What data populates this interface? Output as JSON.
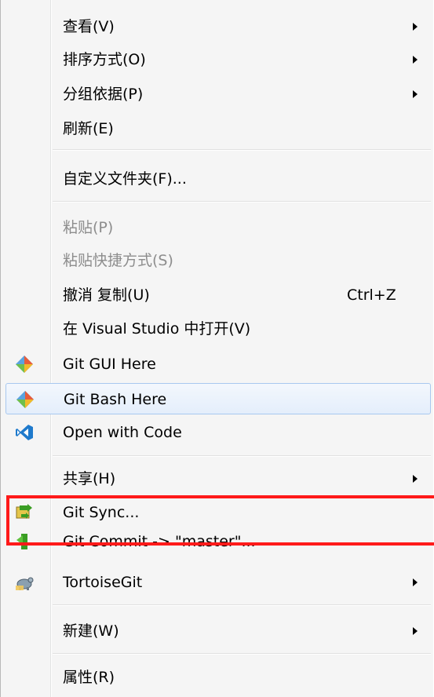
{
  "menu": {
    "view": "查看(V)",
    "sort": "排序方式(O)",
    "group": "分组依据(P)",
    "refresh": "刷新(E)",
    "customize": "自定义文件夹(F)...",
    "paste": "粘贴(P)",
    "paste_shortcut": "粘贴快捷方式(S)",
    "undo": "撤消 复制(U)",
    "undo_shortcut": "Ctrl+Z",
    "open_vs": "在 Visual Studio 中打开(V)",
    "git_gui": "Git GUI Here",
    "git_bash": "Git Bash Here",
    "open_code": "Open with Code",
    "share": "共享(H)",
    "git_sync": "Git Sync...",
    "git_commit": "Git Commit -> \"master\"...",
    "tortoise": "TortoiseGit",
    "new": "新建(W)",
    "properties": "属性(R)"
  },
  "colors": {
    "highlight": "#ff1a1a",
    "hover_border": "#a8c8ef"
  }
}
